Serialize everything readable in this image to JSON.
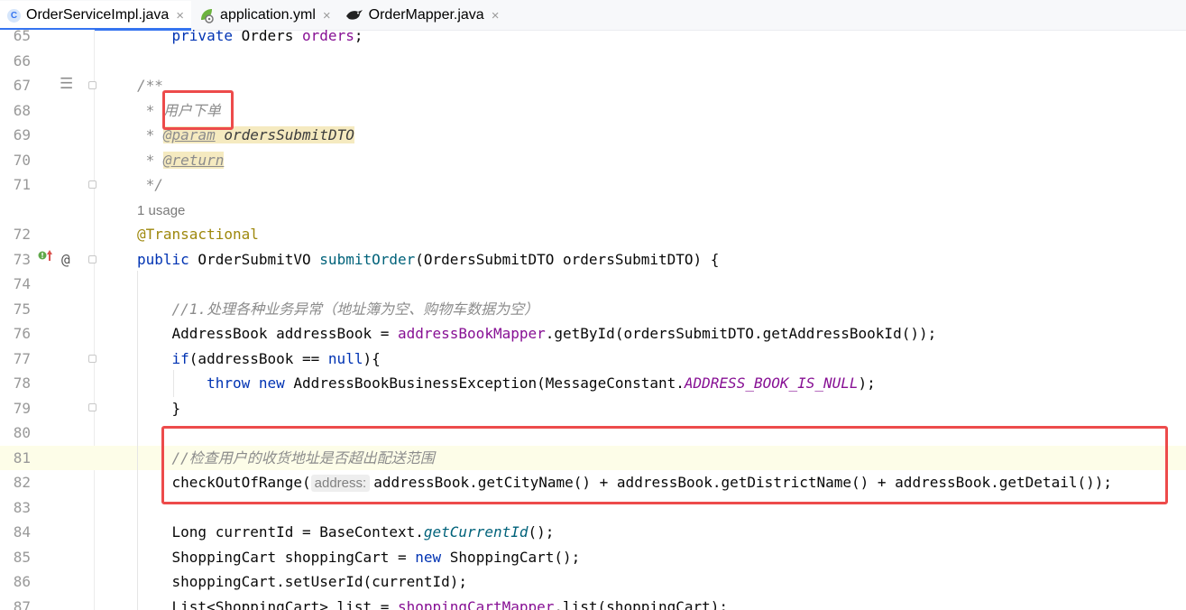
{
  "tabs": [
    {
      "label": "OrderServiceImpl.java",
      "icon": "java-class-icon",
      "icon_glyph": "C",
      "active": true
    },
    {
      "label": "application.yml",
      "icon": "spring-yaml-icon",
      "active": false
    },
    {
      "label": "OrderMapper.java",
      "icon": "mybatis-bird-icon",
      "active": false
    }
  ],
  "close_glyph": "×",
  "gutter_glyphs": {
    "structure": "☰",
    "override": "⬆",
    "at": "@"
  },
  "colors": {
    "keyword": "#0033b3",
    "field": "#871094",
    "method": "#00627a",
    "annotation": "#9e880d",
    "comment": "#8c8c8c",
    "highlight_box": "#ed4b4b",
    "active_tab_underline": "#3574f0"
  },
  "editor": {
    "lines": [
      {
        "num": "65",
        "tokens": [
          [
            "    ",
            ""
          ],
          [
            "private",
            "kw"
          ],
          [
            " Orders ",
            ""
          ],
          [
            "orders",
            "fld"
          ],
          [
            ";",
            ""
          ]
        ]
      },
      {
        "num": "66",
        "tokens": []
      },
      {
        "num": "67",
        "tokens": [
          [
            "/**",
            "cm"
          ]
        ]
      },
      {
        "num": "68",
        "tokens": [
          [
            " * ",
            "cm"
          ],
          [
            "用户下单",
            "cm"
          ]
        ]
      },
      {
        "num": "69",
        "tokens": [
          [
            " * ",
            "cm"
          ],
          [
            "@param",
            "doctag"
          ],
          [
            " ",
            "docparam"
          ],
          [
            "ordersSubmitDTO",
            "docparam"
          ]
        ]
      },
      {
        "num": "70",
        "tokens": [
          [
            " * ",
            "cm"
          ],
          [
            "@return",
            "doctag"
          ]
        ]
      },
      {
        "num": "71",
        "tokens": [
          [
            " */",
            "cm"
          ]
        ]
      },
      {
        "num": "",
        "tokens": [
          [
            "1 usage",
            "usage"
          ]
        ]
      },
      {
        "num": "72",
        "tokens": [
          [
            "@Transactional",
            "ann"
          ]
        ]
      },
      {
        "num": "73",
        "tokens": [
          [
            "public",
            "kw"
          ],
          [
            " OrderSubmitVO ",
            ""
          ],
          [
            "submitOrder",
            "fn"
          ],
          [
            "(OrdersSubmitDTO ordersSubmitDTO) {",
            ""
          ]
        ]
      },
      {
        "num": "74",
        "tokens": []
      },
      {
        "num": "75",
        "tokens": [
          [
            "    ",
            ""
          ],
          [
            "//1.处理各种业务异常（地址簿为空、购物车数据为空）",
            "cm"
          ]
        ]
      },
      {
        "num": "76",
        "tokens": [
          [
            "    AddressBook addressBook = ",
            ""
          ],
          [
            "addressBookMapper",
            "fld"
          ],
          [
            ".getById(ordersSubmitDTO.getAddressBookId());",
            ""
          ]
        ]
      },
      {
        "num": "77",
        "tokens": [
          [
            "    ",
            ""
          ],
          [
            "if",
            "kw"
          ],
          [
            "(addressBook == ",
            ""
          ],
          [
            "null",
            "kw"
          ],
          [
            "){",
            ""
          ]
        ]
      },
      {
        "num": "78",
        "tokens": [
          [
            "        ",
            ""
          ],
          [
            "throw",
            "kw"
          ],
          [
            " ",
            ""
          ],
          [
            "new",
            "kw"
          ],
          [
            " AddressBookBusinessException(MessageConstant.",
            ""
          ],
          [
            "ADDRESS_BOOK_IS_NULL",
            "const"
          ],
          [
            ");",
            ""
          ]
        ]
      },
      {
        "num": "79",
        "tokens": [
          [
            "    }",
            ""
          ]
        ]
      },
      {
        "num": "80",
        "tokens": []
      },
      {
        "num": "81",
        "tokens": [
          [
            "    ",
            ""
          ],
          [
            "//检查用户的收货地址是否超出配送范围",
            "cm"
          ]
        ]
      },
      {
        "num": "82",
        "tokens": [
          [
            "    checkOutOfRange(",
            ""
          ],
          [
            "address:",
            "hint"
          ],
          [
            "addressBook.getCityName() + addressBook.getDistrictName() + addressBook.getDetail());",
            ""
          ]
        ]
      },
      {
        "num": "83",
        "tokens": []
      },
      {
        "num": "84",
        "tokens": [
          [
            "    Long currentId = BaseContext.",
            ""
          ],
          [
            "getCurrentId",
            "static"
          ],
          [
            "();",
            ""
          ]
        ]
      },
      {
        "num": "85",
        "tokens": [
          [
            "    ShoppingCart shoppingCart = ",
            ""
          ],
          [
            "new",
            "kw"
          ],
          [
            " ShoppingCart();",
            ""
          ]
        ]
      },
      {
        "num": "86",
        "tokens": [
          [
            "    shoppingCart.setUserId(currentId);",
            ""
          ]
        ]
      },
      {
        "num": "87",
        "tokens": [
          [
            "    List<ShoppingCart> list = ",
            ""
          ],
          [
            "shoppingCartMapper",
            "fld"
          ],
          [
            ".list(shoppingCart);",
            ""
          ]
        ]
      }
    ]
  }
}
